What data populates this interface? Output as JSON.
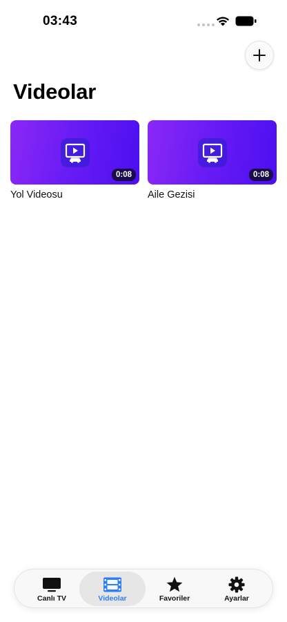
{
  "status_bar": {
    "time": "03:43"
  },
  "header": {
    "title": "Videolar",
    "add_button_icon": "plus-icon"
  },
  "videos": [
    {
      "title": "Yol Videosu",
      "duration": "0:08",
      "thumbnail_icon": "video-car-icon"
    },
    {
      "title": "Aile Gezisi",
      "duration": "0:08",
      "thumbnail_icon": "video-car-icon"
    }
  ],
  "tab_bar": {
    "active_index": 1,
    "active_color": "#2f7ef7",
    "tabs": [
      {
        "label": "Canlı TV",
        "icon": "tv-icon"
      },
      {
        "label": "Videolar",
        "icon": "film-icon"
      },
      {
        "label": "Favoriler",
        "icon": "star-icon"
      },
      {
        "label": "Ayarlar",
        "icon": "gear-icon"
      }
    ]
  },
  "colors": {
    "thumbnail_gradient_start": "#8a28f5",
    "thumbnail_gradient_end": "#4b0ff0"
  }
}
